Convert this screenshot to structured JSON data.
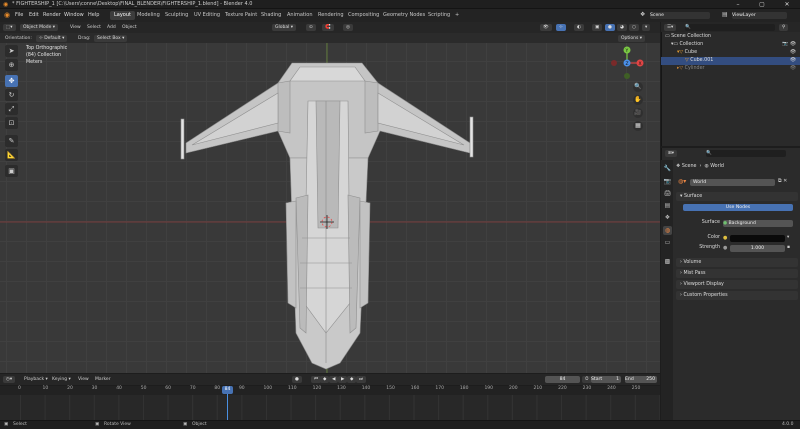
{
  "window": {
    "title": "* FIGHTERSHIP_1 [C:\\Users\\conne\\Desktop\\FINAL_BLENDER\\FIGHTERSHIP_1.blend] - Blender 4.0",
    "minimize": "–",
    "maximize": "▢",
    "close": "✕"
  },
  "menubar": {
    "items": [
      "File",
      "Edit",
      "Render",
      "Window",
      "Help"
    ],
    "workspaces": [
      "Layout",
      "Modeling",
      "Sculpting",
      "UV Editing",
      "Texture Paint",
      "Shading",
      "Animation",
      "Rendering",
      "Compositing",
      "Geometry Nodes",
      "Scripting"
    ],
    "add_workspace": "+",
    "scene_label": "Scene",
    "view_layer_label": "ViewLayer"
  },
  "viewport_header": {
    "mode": "Object Mode",
    "menus": [
      "View",
      "Select",
      "Add",
      "Object"
    ],
    "transform_orientation": "Global",
    "orientation_label": "Orientation:",
    "orientation_value": "Default",
    "drag_label": "Drag:",
    "drag_value": "Select Box",
    "options": "Options"
  },
  "viewport_info": {
    "line1": "Top Orthographic",
    "line2": "(84) Collection",
    "line3": "Meters"
  },
  "gizmo": {
    "x": "X",
    "y": "Y",
    "z": "Z"
  },
  "timeline": {
    "menus": [
      "Playback",
      "Keying",
      "View",
      "Marker"
    ],
    "current_frame": "84",
    "start_label": "Start",
    "start": "1",
    "end_label": "End",
    "end": "250",
    "ticks": [
      "0",
      "10",
      "20",
      "30",
      "40",
      "50",
      "60",
      "70",
      "80",
      "90",
      "100",
      "110",
      "120",
      "130",
      "140",
      "150",
      "160",
      "170",
      "180",
      "190",
      "200",
      "210",
      "220",
      "230",
      "240",
      "250"
    ],
    "playhead_label": "84"
  },
  "statusbar": {
    "select": "Select",
    "rotate": "Rotate View",
    "object": "Object",
    "version": "4.0.0"
  },
  "outliner": {
    "rows": [
      {
        "label": "Scene Collection",
        "indent": 0
      },
      {
        "label": "Collection",
        "indent": 1
      },
      {
        "label": "Cube",
        "indent": 2
      },
      {
        "label": "Cube.001",
        "indent": 3
      },
      {
        "label": "Cylinder",
        "indent": 2
      }
    ]
  },
  "properties": {
    "breadcrumb_scene": "Scene",
    "breadcrumb_world": "World",
    "world_name": "World",
    "surface_panel": "Surface",
    "use_nodes": "Use Nodes",
    "surface_label": "Surface",
    "surface_value": "Background",
    "color_label": "Color",
    "strength_label": "Strength",
    "strength_value": "1.000",
    "panels": [
      "Volume",
      "Mist Pass",
      "Viewport Display",
      "Custom Properties"
    ]
  },
  "colors": {
    "accent": "#4772b3",
    "axis_x": "#e04545",
    "axis_y": "#7ac943",
    "axis_z": "#4a8fe8",
    "ship": "#cfcfcf"
  }
}
